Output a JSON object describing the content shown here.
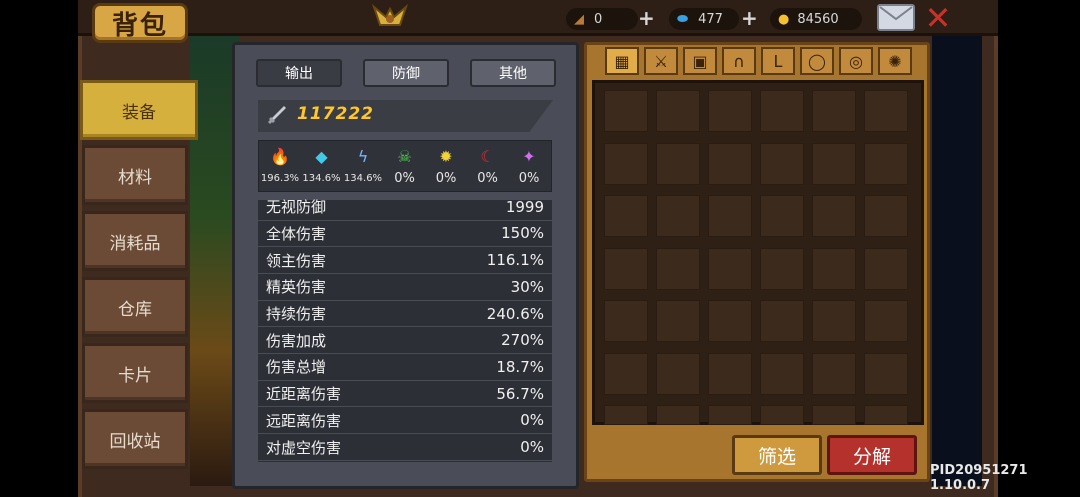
{
  "title": "背包",
  "resources": {
    "wood": "0",
    "gem": "477",
    "gold": "84560"
  },
  "sidebar": {
    "items": [
      {
        "label": "装备"
      },
      {
        "label": "材料"
      },
      {
        "label": "消耗品"
      },
      {
        "label": "仓库"
      },
      {
        "label": "卡片"
      },
      {
        "label": "回收站"
      }
    ]
  },
  "stats_tabs": [
    "输出",
    "防御",
    "其他"
  ],
  "power": "117222",
  "elements": [
    {
      "icon": "fire-icon",
      "value": "196.3%",
      "color": "#f08a2a"
    },
    {
      "icon": "ice-crystal-icon",
      "value": "134.6%",
      "color": "#44c8e8"
    },
    {
      "icon": "lightning-icon",
      "value": "134.6%",
      "color": "#7ab4ff"
    },
    {
      "icon": "poison-skull-icon",
      "value": "0%",
      "color": "#4ccc4c"
    },
    {
      "icon": "sun-icon",
      "value": "0%",
      "color": "#f2d33a"
    },
    {
      "icon": "dark-crescent-icon",
      "value": "0%",
      "color": "#d0303a"
    },
    {
      "icon": "arcane-icon",
      "value": "0%",
      "color": "#d070f0"
    }
  ],
  "stat_rows": [
    {
      "name": "无视防御",
      "value": "1999"
    },
    {
      "name": "全体伤害",
      "value": "150%"
    },
    {
      "name": "领主伤害",
      "value": "116.1%"
    },
    {
      "name": "精英伤害",
      "value": "30%"
    },
    {
      "name": "持续伤害",
      "value": "240.6%"
    },
    {
      "name": "伤害加成",
      "value": "270%"
    },
    {
      "name": "伤害总增",
      "value": "18.7%"
    },
    {
      "name": "近距离伤害",
      "value": "56.7%"
    },
    {
      "name": "远距离伤害",
      "value": "0%"
    },
    {
      "name": "对虚空伤害",
      "value": "0%"
    }
  ],
  "filter_tabs": [
    "all-grid-icon",
    "sword-icon",
    "armor-icon",
    "helmet-icon",
    "boots-icon",
    "necklace-icon",
    "ring-icon",
    "gear-accessory-icon"
  ],
  "buttons": {
    "filter": "筛选",
    "decompose": "分解"
  },
  "pid": "PID20951271 1.10.0.7",
  "colors": {
    "accent_gold": "#d6b03c",
    "power_text": "#ffc72c",
    "decompose_red": "#b4312c"
  }
}
